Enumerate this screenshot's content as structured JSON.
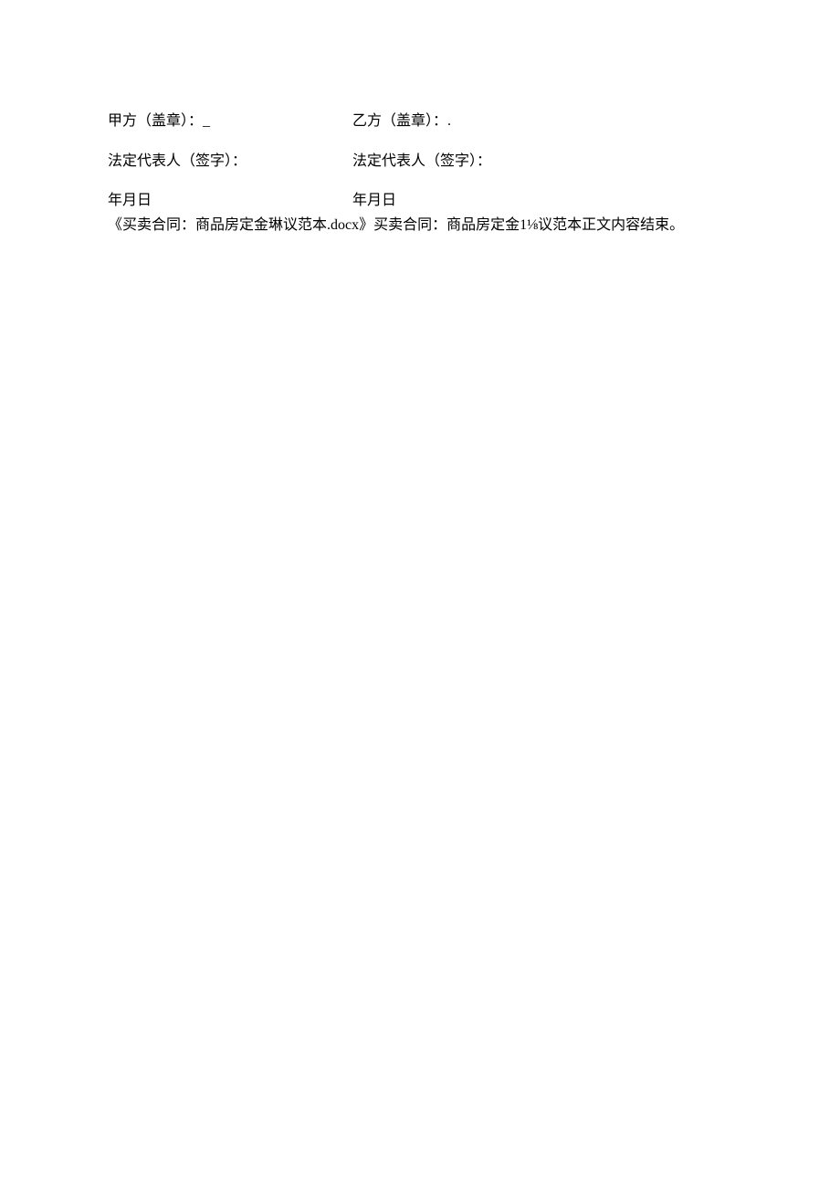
{
  "signature": {
    "party_a_seal": "甲方（盖章）：_",
    "party_b_seal": "乙方（盖章）：.",
    "party_a_rep": "法定代表人（签字）：",
    "party_b_rep": "法定代表人（签字）：",
    "party_a_date": "年月日",
    "party_b_date": "年月日"
  },
  "footer": "《买卖合同：商品房定金琳议范本.docx》买卖合同：商品房定金1⅛议范本正文内容结束。"
}
